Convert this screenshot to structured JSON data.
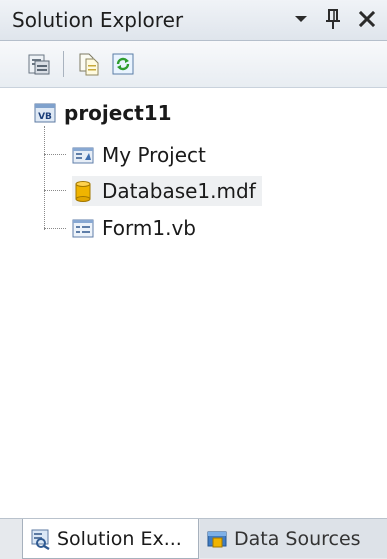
{
  "window": {
    "title": "Solution Explorer"
  },
  "titlebar_icons": [
    "dropdown-arrow-icon",
    "pin-icon",
    "close-icon"
  ],
  "toolbar": {
    "icons": [
      "properties-icon",
      "show-all-files-icon",
      "refresh-icon"
    ]
  },
  "tree": {
    "root": {
      "label": "project11",
      "icon": "vb-project-icon"
    },
    "items": [
      {
        "label": "My Project",
        "icon": "my-project-icon"
      },
      {
        "label": "Database1.mdf",
        "icon": "database-icon",
        "selected": true
      },
      {
        "label": "Form1.vb",
        "icon": "form-icon"
      }
    ]
  },
  "tabs": [
    {
      "label": "Solution Ex...",
      "icon": "solution-explorer-icon",
      "active": true
    },
    {
      "label": "Data Sources",
      "icon": "data-sources-icon",
      "active": false
    }
  ],
  "colors": {
    "titlebar_bg": "#dfe5ec",
    "selection_bg": "#eef0f2",
    "database_gold": "#f0b400"
  }
}
